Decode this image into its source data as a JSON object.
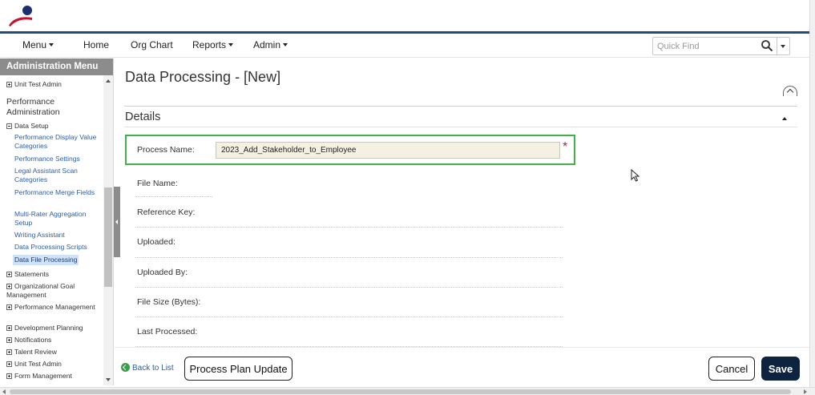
{
  "nav": {
    "menu": "Menu",
    "home": "Home",
    "org_chart": "Org Chart",
    "reports": "Reports",
    "admin": "Admin"
  },
  "quick_find": {
    "placeholder": "Quick Find"
  },
  "sidebar": {
    "header": "Administration Menu",
    "unit_test_admin_top": "Unit Test Admin",
    "performance_admin": "Performance Administration",
    "data_setup": "Data Setup",
    "links": [
      "Performance Display Value Categories",
      "Performance Settings",
      "Legal Assistant Scan Categories",
      "Performance Merge Fields",
      "Multi-Rater Aggregation Setup",
      "Writing Assistant",
      "Data Processing Scripts",
      "Data File Processing"
    ],
    "groups": [
      "Statements",
      "Organizational Goal Management",
      "Performance Management",
      "Development Planning",
      "Notifications",
      "Talent Review",
      "Unit Test Admin",
      "Form Management"
    ]
  },
  "page": {
    "title": "Data Processing - [New]",
    "section": "Details"
  },
  "form": {
    "process_name_label": "Process Name:",
    "process_name_value": "2023_Add_Stakeholder_to_Employee",
    "required_mark": "*",
    "fields": [
      "File Name:",
      "Reference Key:",
      "Uploaded:",
      "Uploaded By:",
      "File Size (Bytes):",
      "Last Processed:"
    ]
  },
  "footer": {
    "back": "Back to List",
    "process_plan_update": "Process Plan Update",
    "cancel": "Cancel",
    "save": "Save"
  },
  "colors": {
    "brand_navy": "#1f4e79",
    "save_button": "#0d2340",
    "highlight_border": "#3fb24a",
    "required": "#b0263b",
    "link": "#2b5ea8"
  }
}
